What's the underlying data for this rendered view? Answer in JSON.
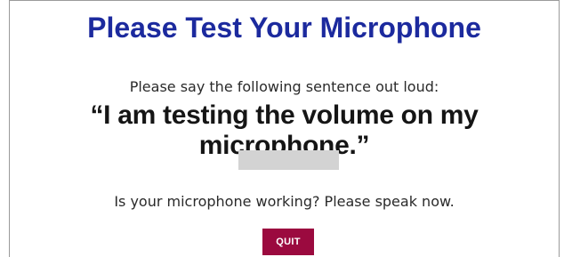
{
  "dialog": {
    "title": "Please Test Your Microphone",
    "instruction": "Please say the following sentence out loud:",
    "sentence": "“I am testing the volume on my microphone.”",
    "prompt": "Is your microphone working? Please speak now.",
    "quit_label": "QUIT"
  },
  "volume_meter": {
    "level": 0
  },
  "colors": {
    "title": "#1c2a9e",
    "quit_button": "#9b0a3f",
    "meter_track": "#d3d3d3"
  }
}
